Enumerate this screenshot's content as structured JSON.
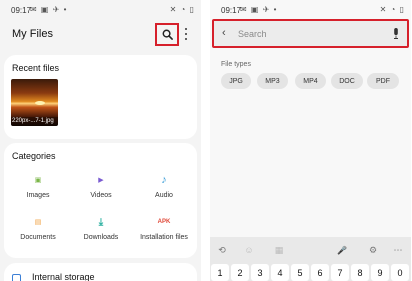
{
  "left_screen": {
    "status": {
      "time": "09:17",
      "left_icons": "✉ ▣ ✈ •",
      "right_icons": "✕ ◔ ▯"
    },
    "app_title": "My Files",
    "recent": {
      "title": "Recent files",
      "file_caption": "220px-...7-1.jpg"
    },
    "categories": {
      "title": "Categories",
      "items": [
        {
          "label": "Images",
          "icon": "image-icon",
          "color": "#7ab648",
          "glyph": "▣"
        },
        {
          "label": "Videos",
          "icon": "video-icon",
          "color": "#7a5bd1",
          "glyph": "▶"
        },
        {
          "label": "Audio",
          "icon": "music-note-icon",
          "color": "#3b9ed8",
          "glyph": "♪"
        },
        {
          "label": "Documents",
          "icon": "document-icon",
          "color": "#f0a040",
          "glyph": "▤"
        },
        {
          "label": "Downloads",
          "icon": "download-icon",
          "color": "#2bb0a0",
          "glyph": "⤓"
        },
        {
          "label": "Installation files",
          "icon": "apk-icon",
          "color": "#e04a3a",
          "glyph": "APK"
        }
      ]
    },
    "storage": {
      "label": "Internal storage"
    }
  },
  "right_screen": {
    "status": {
      "time": "09:17",
      "left_icons": "✉ ▣ ✈ •",
      "right_icons": "✕ ◔ ▯"
    },
    "search": {
      "placeholder": "Search"
    },
    "file_types": {
      "label": "File types",
      "chips": [
        "JPG",
        "MP3",
        "MP4",
        "DOC",
        "PDF"
      ]
    },
    "keyboard": {
      "toolbar_glyphs": [
        "⟲",
        "☺",
        "▦",
        "🎤",
        "⚙",
        "⋯"
      ],
      "number_keys": [
        "1",
        "2",
        "3",
        "4",
        "5",
        "6",
        "7",
        "8",
        "9",
        "0"
      ]
    }
  },
  "colors": {
    "highlight": "#d6202b",
    "screen_bg": "#f4f4f4"
  }
}
